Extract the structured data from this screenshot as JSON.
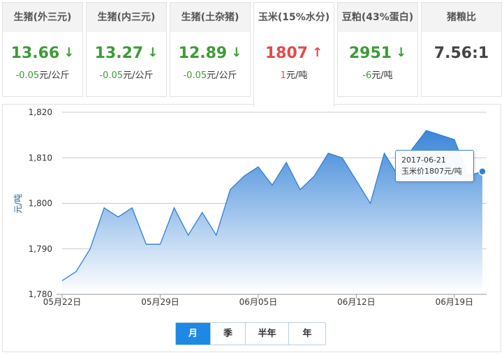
{
  "cards": [
    {
      "title": "生猪(外三元)",
      "value": "13.66",
      "arrow": "↓",
      "change": "-0.05",
      "unit": "元/公斤",
      "color": "#3d9b37"
    },
    {
      "title": "生猪(内三元)",
      "value": "13.27",
      "arrow": "↓",
      "change": "-0.05",
      "unit": "元/公斤",
      "color": "#3d9b37"
    },
    {
      "title": "生猪(土杂猪)",
      "value": "12.89",
      "arrow": "↓",
      "change": "-0.05",
      "unit": "元/公斤",
      "color": "#3d9b37"
    },
    {
      "title": "玉米(15%水分)",
      "value": "1807",
      "arrow": "↑",
      "change": "1",
      "unit": "元/吨",
      "color": "#e04b4b"
    },
    {
      "title": "豆粕(43%蛋白)",
      "value": "2951",
      "arrow": "↓",
      "change": "-6",
      "unit": "元/吨",
      "color": "#3d9b37"
    },
    {
      "title": "猪粮比",
      "value": "7.56:1",
      "arrow": "",
      "change": "",
      "unit": "",
      "color": "#444444"
    }
  ],
  "tooltip": {
    "date": "2017-06-21",
    "label": "玉米价1807元/吨"
  },
  "range_buttons": [
    "月",
    "季",
    "半年",
    "年"
  ],
  "chart_data": {
    "type": "area",
    "ylabel": "元/吨",
    "ylim": [
      1780,
      1820
    ],
    "yticks": [
      "1,780",
      "1,790",
      "1,800",
      "1,810",
      "1,820"
    ],
    "xticks": [
      "05月22日",
      "05月29日",
      "06月05日",
      "06月12日",
      "06月19日"
    ],
    "series": [
      {
        "values": [
          1783,
          1785,
          1790,
          1799,
          1797,
          1799,
          1791,
          1791,
          1799,
          1793,
          1798,
          1793,
          1803,
          1806,
          1808,
          1804,
          1809,
          1803,
          1806,
          1811,
          1810,
          1805,
          1800,
          1811,
          1806,
          1812,
          1816,
          1815,
          1814,
          1806,
          1807
        ]
      }
    ],
    "grid": true,
    "color": "#2f7fd6"
  }
}
